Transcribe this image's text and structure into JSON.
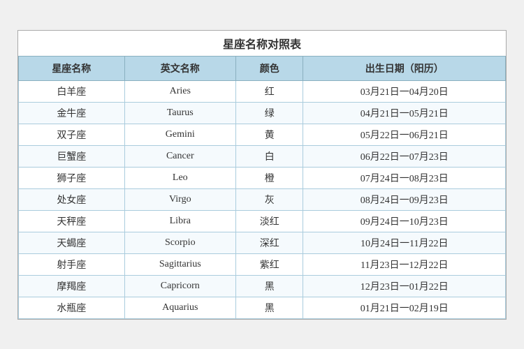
{
  "title": "星座名称对照表",
  "headers": [
    "星座名称",
    "英文名称",
    "颜色",
    "出生日期（阳历）"
  ],
  "rows": [
    {
      "chinese": "白羊座",
      "english": "Aries",
      "color": "红",
      "date": "03月21日一04月20日"
    },
    {
      "chinese": "金牛座",
      "english": "Taurus",
      "color": "绿",
      "date": "04月21日一05月21日"
    },
    {
      "chinese": "双子座",
      "english": "Gemini",
      "color": "黄",
      "date": "05月22日一06月21日"
    },
    {
      "chinese": "巨蟹座",
      "english": "Cancer",
      "color": "白",
      "date": "06月22日一07月23日"
    },
    {
      "chinese": "狮子座",
      "english": "Leo",
      "color": "橙",
      "date": "07月24日一08月23日"
    },
    {
      "chinese": "处女座",
      "english": "Virgo",
      "color": "灰",
      "date": "08月24日一09月23日"
    },
    {
      "chinese": "天秤座",
      "english": "Libra",
      "color": "淡红",
      "date": "09月24日一10月23日"
    },
    {
      "chinese": "天蝎座",
      "english": "Scorpio",
      "color": "深红",
      "date": "10月24日一11月22日"
    },
    {
      "chinese": "射手座",
      "english": "Sagittarius",
      "color": "紫红",
      "date": "11月23日一12月22日"
    },
    {
      "chinese": "摩羯座",
      "english": "Capricorn",
      "color": "黑",
      "date": "12月23日一01月22日"
    },
    {
      "chinese": "水瓶座",
      "english": "Aquarius",
      "color": "黑",
      "date": "01月21日一02月19日"
    }
  ]
}
